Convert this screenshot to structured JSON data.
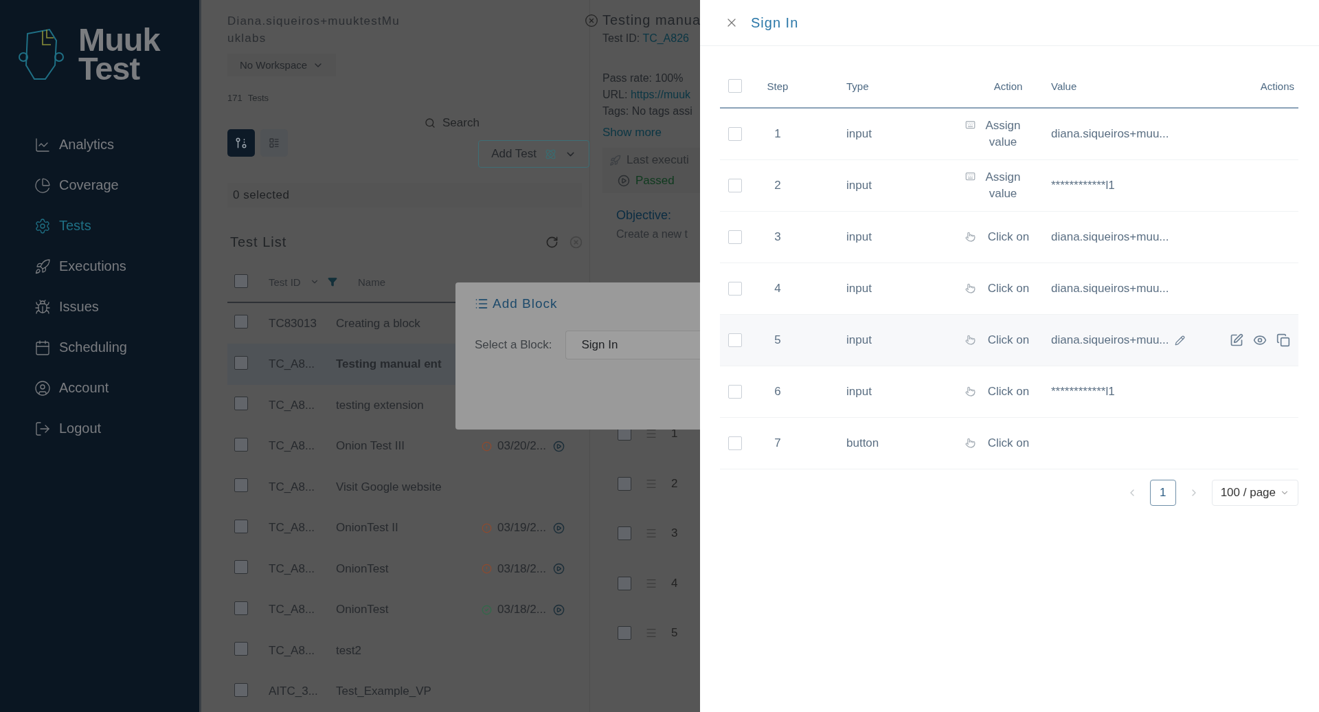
{
  "sidebar": {
    "logo": [
      "Muuk",
      "Test"
    ],
    "items": [
      {
        "label": "Analytics",
        "selected": false
      },
      {
        "label": "Coverage",
        "selected": false
      },
      {
        "label": "Tests",
        "selected": true
      },
      {
        "label": "Executions",
        "selected": false
      },
      {
        "label": "Issues",
        "selected": false
      },
      {
        "label": "Scheduling",
        "selected": false
      },
      {
        "label": "Account",
        "selected": false
      },
      {
        "label": "Logout",
        "selected": false
      }
    ]
  },
  "tests": {
    "user_lines": [
      "Diana.siqueiros+muuktestMu",
      "uklabs"
    ],
    "workspace": "No Workspace",
    "count": "171",
    "count_label": "Tests",
    "search_placeholder": "Search",
    "view_modes": [
      {
        "selected": true
      },
      {
        "selected": false
      }
    ],
    "add_test": "Add Test",
    "selected_count": "0 selected",
    "title": "Test List",
    "columns": [
      "Test ID",
      "Name"
    ],
    "all_checked": false,
    "rows": [
      {
        "id": "TC83013",
        "name": "Creating a block",
        "selected": false,
        "checked": false,
        "kind": "plain"
      },
      {
        "id": "TC_A8...",
        "name": "Testing manual ent",
        "selected": true,
        "checked": false,
        "kind": "plain"
      },
      {
        "id": "TC_A8...",
        "name": "testing extension",
        "selected": false,
        "checked": false,
        "kind": "plain"
      },
      {
        "id": "TC_A8...",
        "name": "Onion Test III",
        "selected": false,
        "checked": false,
        "kind": "warning",
        "date": "03/20/2..."
      },
      {
        "id": "TC_A8...",
        "name": "Visit Google website",
        "selected": false,
        "checked": false,
        "kind": "plain"
      },
      {
        "id": "TC_A8...",
        "name": "OnionTest II",
        "selected": false,
        "checked": false,
        "kind": "warning",
        "date": "03/19/2..."
      },
      {
        "id": "TC_A8...",
        "name": "OnionTest",
        "selected": false,
        "checked": false,
        "kind": "warning",
        "date": "03/18/2..."
      },
      {
        "id": "TC_A8...",
        "name": "OnionTest",
        "selected": false,
        "checked": false,
        "kind": "passed",
        "date": "03/18/2..."
      },
      {
        "id": "TC_A8...",
        "name": "test2",
        "selected": false,
        "checked": false,
        "kind": "plain"
      },
      {
        "id": "AITC_3...",
        "name": "Test_Example_VP",
        "selected": false,
        "checked": false,
        "kind": "plain"
      }
    ]
  },
  "detail": {
    "title": "Testing manua",
    "test_id_label": "Test ID:",
    "test_id": "TC_A826",
    "pass_rate": "Pass rate: 100%",
    "url_label": "URL:",
    "url": "https://muuk",
    "tags": "Tags: No tags assi",
    "show_more": "Show more",
    "last_execution": "Last executi",
    "result": "Passed",
    "objective_label": "Objective:",
    "objective": "Create a new t",
    "steps": [
      {
        "number": "1",
        "checked": false
      },
      {
        "number": "2",
        "checked": false
      },
      {
        "number": "3",
        "checked": false
      },
      {
        "number": "4",
        "checked": false
      },
      {
        "number": "5",
        "checked": false
      }
    ]
  },
  "modal": {
    "title": "Add Block",
    "label": "Select a Block:",
    "value": "Sign In"
  },
  "drawer": {
    "title": "Sign In",
    "columns": [
      "Step",
      "Type",
      "Action",
      "Value",
      "Actions"
    ],
    "all_checked": false,
    "steps": [
      {
        "step": "1",
        "type": "input",
        "kind": "assign",
        "action": "Assign value",
        "value": "diana.siqueiros+muu...",
        "hovered": false,
        "checked": false
      },
      {
        "step": "2",
        "type": "input",
        "kind": "assign",
        "action": "Assign value",
        "value": "************l1",
        "hovered": false,
        "checked": false
      },
      {
        "step": "3",
        "type": "input",
        "kind": "click",
        "action": "Click on",
        "value": "diana.siqueiros+muu...",
        "hovered": false,
        "checked": false
      },
      {
        "step": "4",
        "type": "input",
        "kind": "click",
        "action": "Click on",
        "value": "diana.siqueiros+muu...",
        "hovered": false,
        "checked": false
      },
      {
        "step": "5",
        "type": "input",
        "kind": "click",
        "action": "Click on",
        "value": "diana.siqueiros+muu...",
        "hovered": true,
        "checked": false
      },
      {
        "step": "6",
        "type": "input",
        "kind": "click",
        "action": "Click on",
        "value": "************l1",
        "hovered": false,
        "checked": false
      },
      {
        "step": "7",
        "type": "button",
        "kind": "click",
        "action": "Click on",
        "hovered": false,
        "checked": false
      }
    ],
    "pages": [
      {
        "label": "1",
        "selected": true
      }
    ],
    "page_size": "100 / page"
  }
}
